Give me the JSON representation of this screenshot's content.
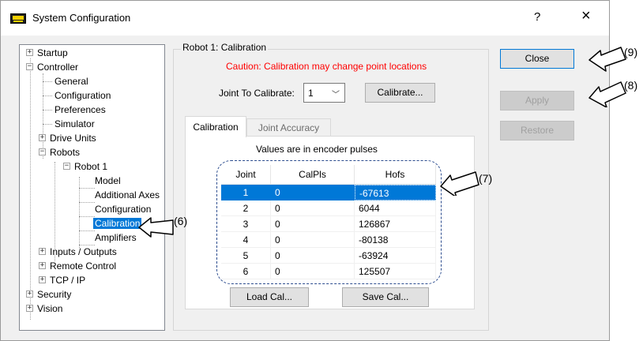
{
  "window": {
    "title": "System Configuration",
    "help_label": "?",
    "close_label": "×"
  },
  "tree": {
    "items": [
      {
        "label": "Startup",
        "glyph": "+"
      },
      {
        "label": "Controller",
        "glyph": "−"
      },
      {
        "label": "General"
      },
      {
        "label": "Configuration"
      },
      {
        "label": "Preferences"
      },
      {
        "label": "Simulator"
      },
      {
        "label": "Drive Units",
        "glyph": "+"
      },
      {
        "label": "Robots",
        "glyph": "−"
      },
      {
        "label": "Robot 1",
        "glyph": "−"
      },
      {
        "label": "Model"
      },
      {
        "label": "Additional Axes"
      },
      {
        "label": "Configuration"
      },
      {
        "label": "Calibration",
        "selected": true
      },
      {
        "label": "Amplifiers"
      },
      {
        "label": "Inputs / Outputs",
        "glyph": "+"
      },
      {
        "label": "Remote Control",
        "glyph": "+"
      },
      {
        "label": "TCP / IP",
        "glyph": "+"
      },
      {
        "label": "Security",
        "glyph": "+"
      },
      {
        "label": "Vision",
        "glyph": "+"
      }
    ]
  },
  "panel": {
    "group_title": "Robot 1: Calibration",
    "caution": "Caution: Calibration may change point locations",
    "joint_label": "Joint To Calibrate:",
    "joint_value": "1",
    "calibrate_button": "Calibrate...",
    "tabs": [
      "Calibration",
      "Joint Accuracy"
    ],
    "values_note": "Values are in encoder pulses",
    "grid": {
      "headers": [
        "Joint",
        "CalPls",
        "Hofs"
      ],
      "rows": [
        [
          "1",
          "0",
          "-67613"
        ],
        [
          "2",
          "0",
          "6044"
        ],
        [
          "3",
          "0",
          "126867"
        ],
        [
          "4",
          "0",
          "-80138"
        ],
        [
          "5",
          "0",
          "-63924"
        ],
        [
          "6",
          "0",
          "125507"
        ]
      ],
      "selected_row": 0
    },
    "load_button": "Load Cal...",
    "save_button": "Save Cal..."
  },
  "buttons": {
    "close": "Close",
    "apply": "Apply",
    "restore": "Restore"
  },
  "callouts": {
    "c6": "(6)",
    "c7": "(7)",
    "c8": "(8)",
    "c9": "(9)"
  },
  "colors": {
    "selection": "#0078d7",
    "caution": "#ff0000",
    "outline": "#2d4d8f"
  }
}
